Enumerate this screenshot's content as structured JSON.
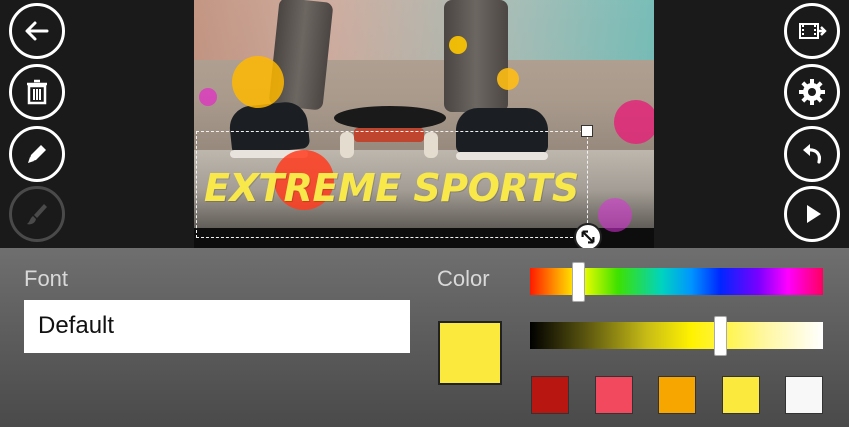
{
  "toolbar_left": {
    "back": "back-arrow-icon",
    "delete": "trash-icon",
    "edit": "pencil-icon",
    "brush": "brush-icon"
  },
  "toolbar_right": {
    "export": "film-export-icon",
    "settings": "gear-icon",
    "undo": "undo-icon",
    "play": "play-icon"
  },
  "canvas": {
    "overlay_text": "EXTREME SPORTS",
    "text_color": "#f9e84a"
  },
  "panel": {
    "font_label": "Font",
    "font_value": "Default",
    "color_label": "Color",
    "selected_color": "#fbe93d",
    "hue_position": 0.165,
    "shade_position": 0.65,
    "presets": [
      {
        "name": "dark-red",
        "color": "#b81610"
      },
      {
        "name": "pink",
        "color": "#f2495f"
      },
      {
        "name": "orange",
        "color": "#f7a600"
      },
      {
        "name": "yellow",
        "color": "#fbe93d"
      },
      {
        "name": "white",
        "color": "#f8f8f8"
      }
    ]
  }
}
